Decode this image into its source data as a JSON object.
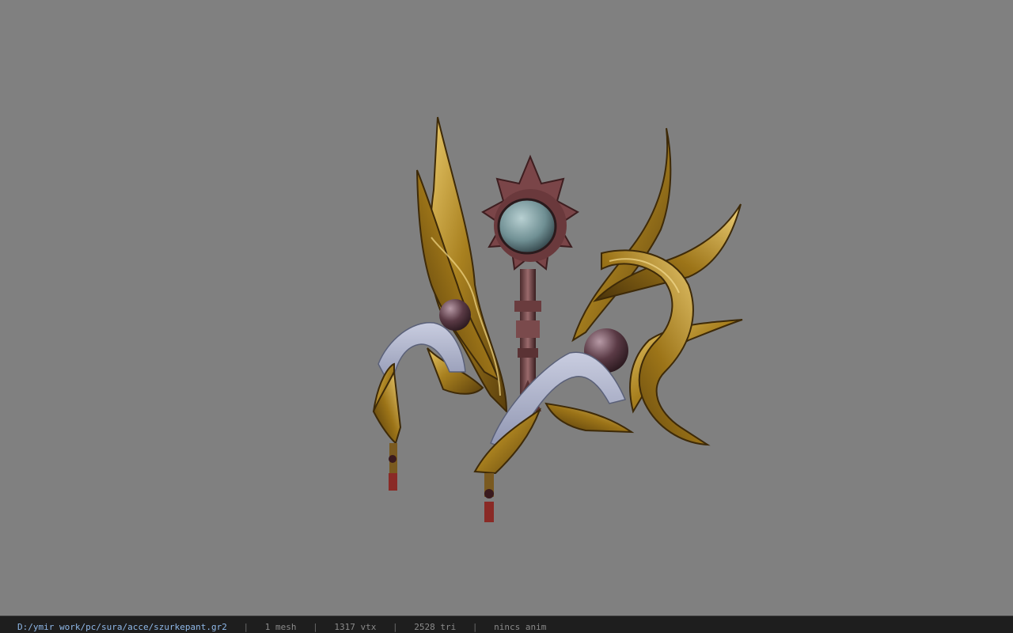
{
  "viewport": {
    "background_color": "#808080",
    "model_name": "szurkepant"
  },
  "statusbar": {
    "file_path": "D:/ymir work/pc/sura/acce/szurkepant.gr2",
    "separator": "|",
    "mesh_count": "1 mesh",
    "vertex_count": "1317 vtx",
    "triangle_count": "2528 tri",
    "animation": "nincs anim"
  },
  "colors": {
    "statusbar_bg": "#1e1e1e",
    "path_text": "#8fb8e8",
    "stat_text": "#8a8a8a",
    "gold": "#b8902e",
    "cloth": "#aab0c8",
    "sun_disc": "#6e3a3a"
  }
}
